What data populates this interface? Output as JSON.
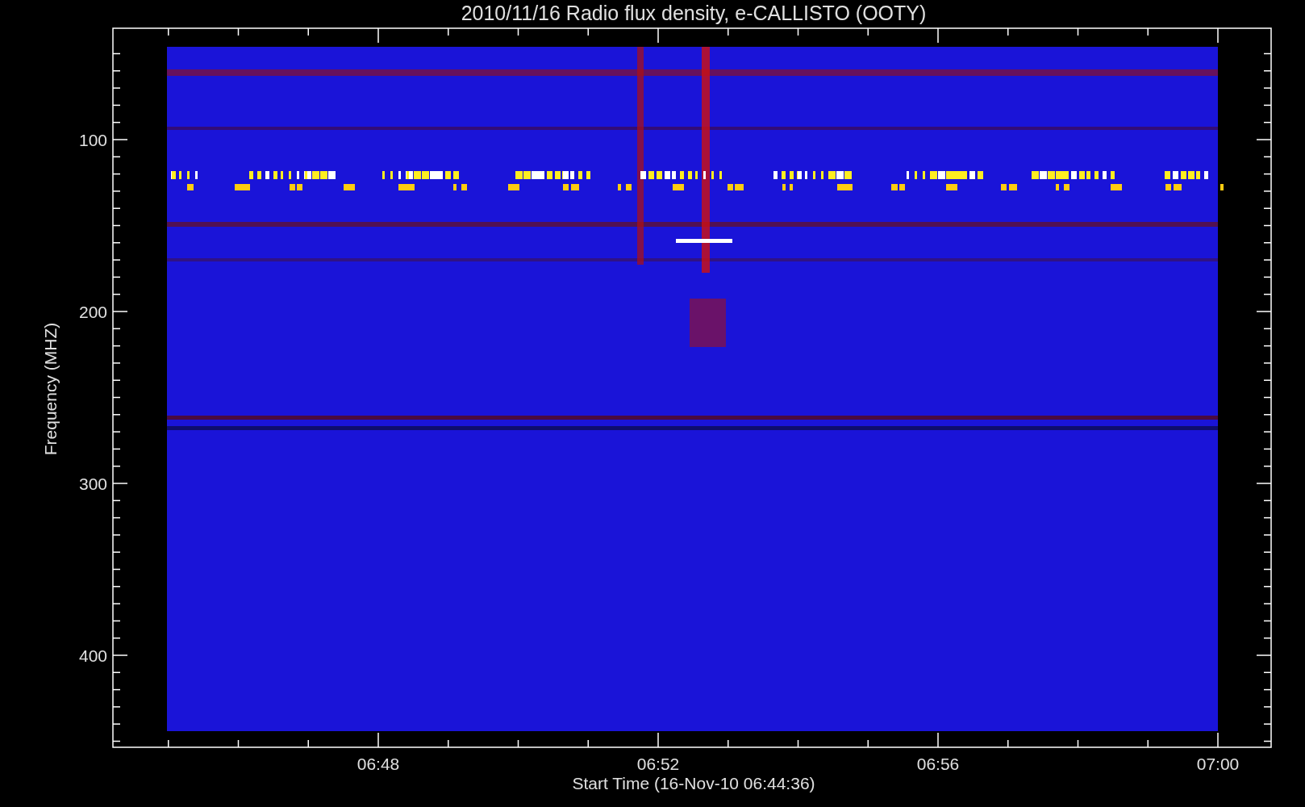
{
  "title": "2010/11/16  Radio flux density, e-CALLISTO (OOTY)",
  "y_axis": {
    "label": "Frequency (MHZ)",
    "ticks": [
      "100",
      "200",
      "300",
      "400"
    ]
  },
  "x_axis": {
    "label": "Start Time (16-Nov-10 06:44:36)",
    "ticks": [
      "06:48",
      "06:52",
      "06:56",
      "07:00"
    ]
  }
}
